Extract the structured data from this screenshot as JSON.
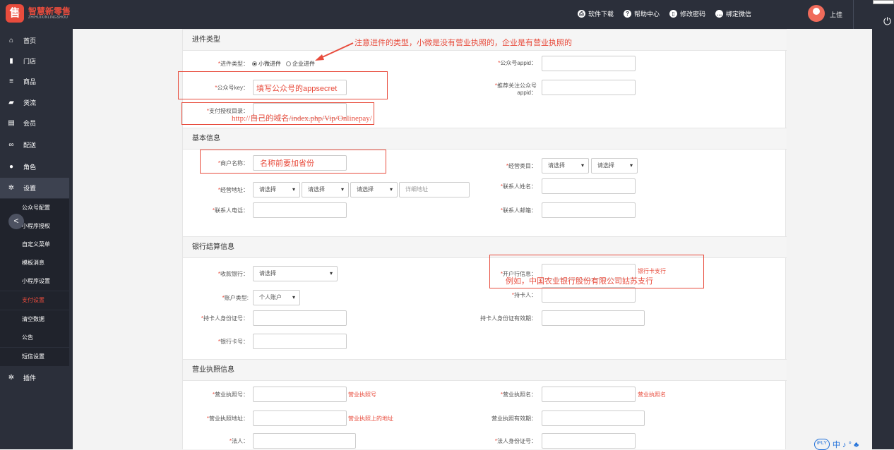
{
  "header": {
    "brand": "智慧新零售",
    "brand_sub": "ZHIHUIXINLINGSHOU",
    "logo_char": "售",
    "nav": [
      {
        "label": "软件下载",
        "icon": "printer-icon",
        "glyph": "⎙"
      },
      {
        "label": "帮助中心",
        "icon": "question-icon",
        "glyph": "?"
      },
      {
        "label": "修改密码",
        "icon": "thermometer-icon",
        "glyph": "▯"
      },
      {
        "label": "绑定微信",
        "icon": "chat-icon",
        "glyph": "…"
      }
    ],
    "user": "上佳"
  },
  "sidebar": {
    "items": [
      {
        "label": "首页",
        "icon": "home-icon",
        "glyph": "⌂"
      },
      {
        "label": "门店",
        "icon": "store-icon",
        "glyph": "▮"
      },
      {
        "label": "商品",
        "icon": "list-icon",
        "glyph": "≡"
      },
      {
        "label": "货流",
        "icon": "truck-icon",
        "glyph": "▰"
      },
      {
        "label": "会员",
        "icon": "id-card-icon",
        "glyph": "▤"
      },
      {
        "label": "配送",
        "icon": "motorcycle-icon",
        "glyph": "∞"
      },
      {
        "label": "角色",
        "icon": "user-circle-icon",
        "glyph": "●"
      },
      {
        "label": "设置",
        "icon": "gear-icon",
        "glyph": "✲"
      }
    ],
    "sub_items": [
      "公众号配置",
      "小程序授权",
      "自定义菜单",
      "模板消息",
      "小程序设置",
      "支付设置",
      "清空数据",
      "公告",
      "短信设置"
    ],
    "active_sub": "支付设置",
    "plugin": {
      "label": "插件",
      "icon": "gears-icon",
      "glyph": "✲"
    },
    "collapse_glyph": "<"
  },
  "sections": {
    "type": "进件类型",
    "basic": "基本信息",
    "bank": "银行结算信息",
    "license": "营业执照信息"
  },
  "form": {
    "jinjian_type": {
      "label": "进件类型：",
      "options": [
        "小微进件",
        "企业进件"
      ],
      "selected": "小微进件"
    },
    "gzh_appid": {
      "label": "公众号appid："
    },
    "gzh_key": {
      "label": "公众号key：",
      "value": ""
    },
    "tuijian_appid": {
      "label_line1": "推荐关注公众号",
      "label_line2": "appid："
    },
    "pay_dir": {
      "label": "支付授权目录："
    },
    "shop_name": {
      "label": "商户名称："
    },
    "jingying_leimu": {
      "label": "经营类目：",
      "select1": "请选择",
      "select2": "请选择"
    },
    "jingying_addr": {
      "label": "经营地址：",
      "select1": "请选择",
      "select2": "请选择",
      "select3": "请选择",
      "detail_placeholder": "详细地址"
    },
    "contact_name": {
      "label": "联系人姓名："
    },
    "contact_phone": {
      "label": "联系人电话："
    },
    "contact_email": {
      "label": "联系人邮箱："
    },
    "bank": {
      "label": "收款银行：",
      "value": "请选择"
    },
    "bank_branch": {
      "label": "开户行信息：",
      "hint": "银行卡支行"
    },
    "account_type": {
      "label": "账户类型:",
      "value": "个人账户"
    },
    "card_holder": {
      "label": "持卡人："
    },
    "holder_id": {
      "label": "持卡人身份证号："
    },
    "holder_id_expiry": {
      "label": "持卡人身份证有效期："
    },
    "card_no": {
      "label": "银行卡号："
    },
    "license_no": {
      "label": "营业执照号：",
      "hint": "营业执照号"
    },
    "license_name": {
      "label": "营业执照名：",
      "hint": "营业执照名"
    },
    "license_addr": {
      "label": "营业执照地址：",
      "hint": "营业执照上的地址"
    },
    "license_expiry": {
      "label": "营业执照有效期："
    },
    "legal_person": {
      "label": "法人："
    },
    "legal_id": {
      "label": "法人身份证号："
    }
  },
  "annotations": {
    "type_note": "注意进件的类型，小微是没有营业执照的，企业是有营业执照的",
    "key_note": "填写公众号的appsecret",
    "dir_note": "http://自己的域名/index.php/Vip/Onlinepay/",
    "name_note": "名称前要加省份",
    "bank_note": "例如，中国农业银行股份有限公司姑苏支行"
  },
  "ime": {
    "badge": "iFLY",
    "text": "中 ♪ ° ♣"
  },
  "colors": {
    "accent": "#e84c3d",
    "sidebar_bg": "#2b2f3a"
  }
}
